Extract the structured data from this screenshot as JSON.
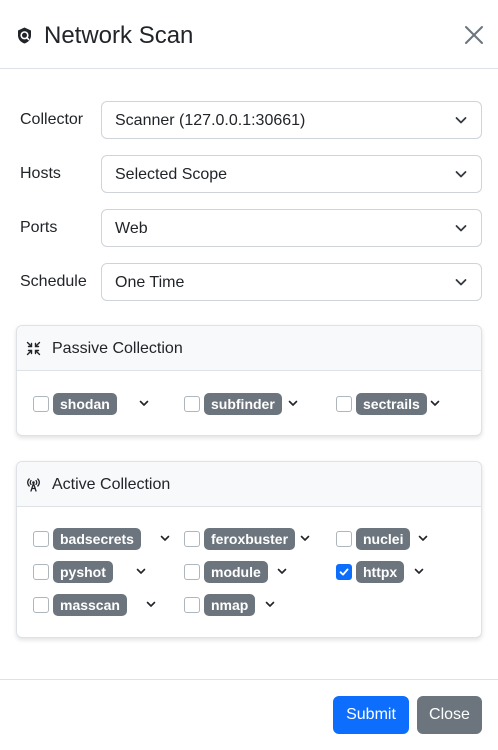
{
  "modal": {
    "title": "Network Scan"
  },
  "form": {
    "collector": {
      "label": "Collector",
      "value": "Scanner (127.0.0.1:30661)"
    },
    "hosts": {
      "label": "Hosts",
      "value": "Selected Scope"
    },
    "ports": {
      "label": "Ports",
      "value": "Web"
    },
    "schedule": {
      "label": "Schedule",
      "value": "One Time"
    }
  },
  "passive": {
    "title": "Passive Collection",
    "tools": [
      {
        "name": "shodan",
        "checked": false
      },
      {
        "name": "subfinder",
        "checked": false
      },
      {
        "name": "sectrails",
        "checked": false
      }
    ]
  },
  "active": {
    "title": "Active Collection",
    "tools": [
      {
        "name": "badsecrets",
        "checked": false
      },
      {
        "name": "feroxbuster",
        "checked": false
      },
      {
        "name": "nuclei",
        "checked": false
      },
      {
        "name": "pyshot",
        "checked": false
      },
      {
        "name": "module",
        "checked": false
      },
      {
        "name": "httpx",
        "checked": true
      },
      {
        "name": "masscan",
        "checked": false
      },
      {
        "name": "nmap",
        "checked": false
      }
    ]
  },
  "footer": {
    "submit_label": "Submit",
    "close_label": "Close"
  },
  "colors": {
    "primary": "#0d6efd",
    "secondary": "#6c757d",
    "border": "#dee2e6"
  },
  "icons": {
    "header": "shield-icon",
    "close": "close-icon",
    "passive": "compress-arrows-icon",
    "active": "broadcast-tower-icon",
    "select_caret": "chevron-down-icon",
    "tool_caret": "chevron-down-icon"
  }
}
